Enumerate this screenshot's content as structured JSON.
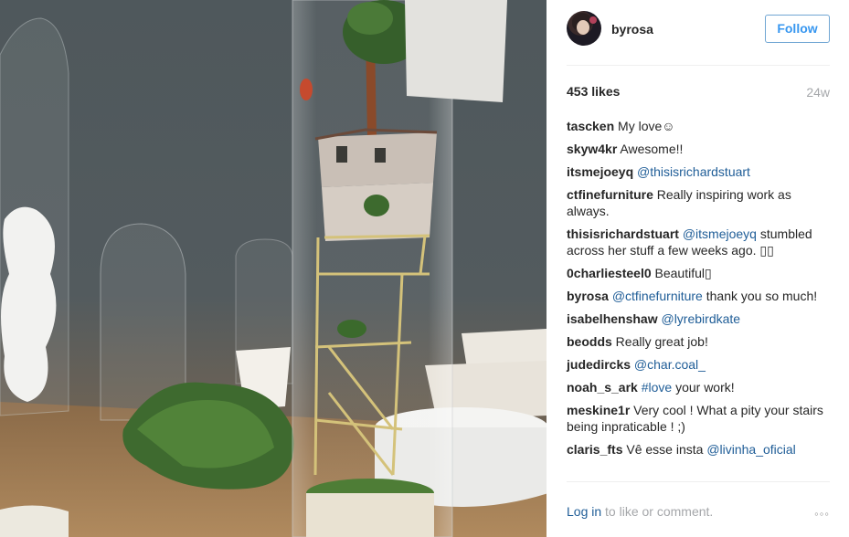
{
  "post": {
    "photo_alt": "",
    "username": "byrosa",
    "follow_label": "Follow",
    "likes": "453 likes",
    "age": "24w"
  },
  "comments": [
    {
      "user": "tascken",
      "parts": [
        {
          "t": "text",
          "v": " My love☺"
        }
      ]
    },
    {
      "user": "skyw4kr",
      "parts": [
        {
          "t": "text",
          "v": " Awesome!!"
        }
      ]
    },
    {
      "user": "itsmejoeyq",
      "parts": [
        {
          "t": "text",
          "v": " "
        },
        {
          "t": "mention",
          "v": "@thisisrichardstuart"
        }
      ]
    },
    {
      "user": "ctfinefurniture",
      "parts": [
        {
          "t": "text",
          "v": " Really inspiring work as always."
        }
      ]
    },
    {
      "user": "thisisrichardstuart",
      "parts": [
        {
          "t": "text",
          "v": " "
        },
        {
          "t": "mention",
          "v": "@itsmejoeyq"
        },
        {
          "t": "text",
          "v": " stumbled across her stuff a few weeks ago. ▯▯"
        }
      ]
    },
    {
      "user": "0charliesteel0",
      "parts": [
        {
          "t": "text",
          "v": " Beautiful▯"
        }
      ]
    },
    {
      "user": "byrosa",
      "parts": [
        {
          "t": "text",
          "v": " "
        },
        {
          "t": "mention",
          "v": "@ctfinefurniture"
        },
        {
          "t": "text",
          "v": " thank you so much!"
        }
      ]
    },
    {
      "user": "isabelhenshaw",
      "parts": [
        {
          "t": "text",
          "v": " "
        },
        {
          "t": "mention",
          "v": "@lyrebirdkate"
        }
      ]
    },
    {
      "user": "beodds",
      "parts": [
        {
          "t": "text",
          "v": " Really great job!"
        }
      ]
    },
    {
      "user": "judedircks",
      "parts": [
        {
          "t": "text",
          "v": " "
        },
        {
          "t": "mention",
          "v": "@char.coal_"
        }
      ]
    },
    {
      "user": "noah_s_ark",
      "parts": [
        {
          "t": "text",
          "v": " "
        },
        {
          "t": "mention",
          "v": "#love"
        },
        {
          "t": "text",
          "v": " your work!"
        }
      ]
    },
    {
      "user": "meskine1r",
      "parts": [
        {
          "t": "text",
          "v": " Very cool ! What a pity your stairs being inpraticable ! ;)"
        }
      ]
    },
    {
      "user": "claris_fts",
      "parts": [
        {
          "t": "text",
          "v": " Vê esse insta "
        },
        {
          "t": "mention",
          "v": "@livinha_oficial"
        }
      ]
    }
  ],
  "footer": {
    "login_link": "Log in",
    "login_rest": " to like or comment.",
    "more_icon": "more-options-icon",
    "more_glyph": "◦◦◦"
  },
  "colors": {
    "link": "#1f5d97",
    "follow_blue": "#3897f0",
    "muted": "#a5a7aa"
  }
}
